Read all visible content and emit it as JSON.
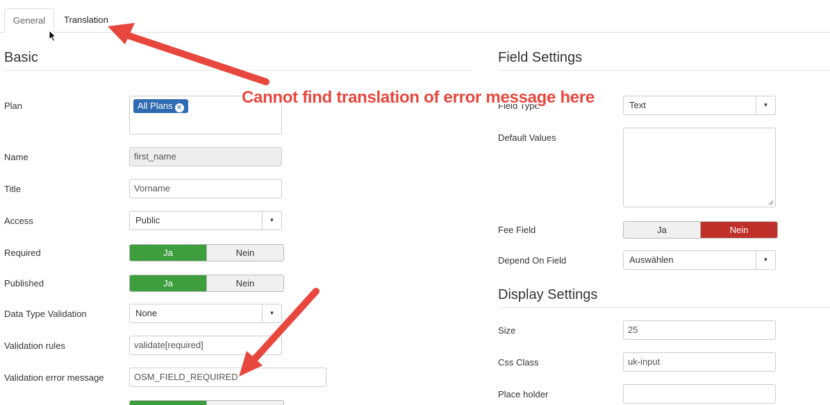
{
  "tabs": {
    "general": "General",
    "translation": "Translation"
  },
  "basic": {
    "title": "Basic",
    "plan_label": "Plan",
    "plan_chip": "All Plans",
    "name_label": "Name",
    "name_value": "first_name",
    "title_label": "Title",
    "title_value": "Vorname",
    "access_label": "Access",
    "access_value": "Public",
    "required_label": "Required",
    "published_label": "Published",
    "yes": "Ja",
    "no": "Nein",
    "datatype_label": "Data Type Validation",
    "datatype_value": "None",
    "rules_label": "Validation rules",
    "rules_value": "validate[required]",
    "errmsg_label": "Validation error message",
    "errmsg_value": "OSM_FIELD_REQUIRED"
  },
  "field_settings": {
    "title": "Field Settings",
    "fieldtype_label": "Field Type",
    "fieldtype_value": "Text",
    "default_label": "Default Values",
    "fee_label": "Fee Field",
    "depend_label": "Depend On Field",
    "depend_value": "Auswählen"
  },
  "display_settings": {
    "title": "Display Settings",
    "size_label": "Size",
    "size_value": "25",
    "css_label": "Css Class",
    "css_value": "uk-input",
    "placeholder_label": "Place holder",
    "placeholder_value": ""
  },
  "annotation": {
    "text": "Cannot find translation of error message here",
    "color": "#e8473d"
  },
  "colors": {
    "green": "#3e9e3e",
    "red": "#c0302a",
    "chip": "#2f6bb1"
  }
}
